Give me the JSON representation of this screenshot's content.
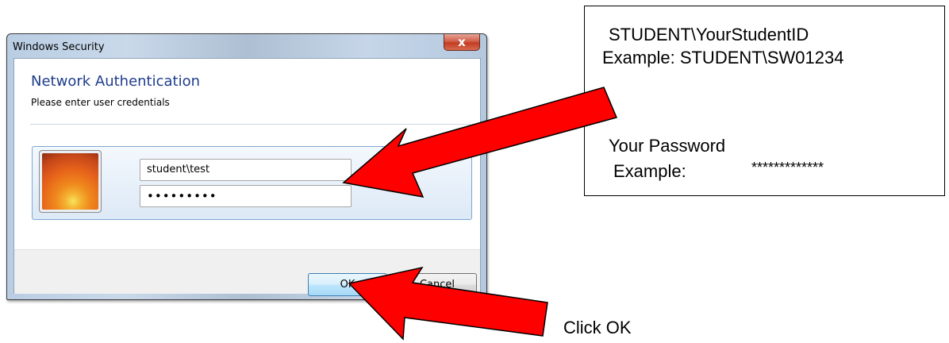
{
  "window": {
    "title": "Windows Security",
    "close_glyph": "x",
    "heading": "Network Authentication",
    "subtext": "Please enter user credentials"
  },
  "credentials": {
    "username_value": "student\\test",
    "password_value": "•••••••••",
    "avatar_icon": "flower-user-tile-icon"
  },
  "buttons": {
    "ok_label": "OK",
    "cancel_label": "Cancel"
  },
  "annotation": {
    "username_format": "STUDENT\\YourStudentID",
    "username_example": "Example: STUDENT\\SW01234",
    "password_label": "Your Password",
    "password_example_label": "Example:",
    "password_example_value": "*************",
    "click_instruction": "Click OK",
    "arrow_color": "#ff0000"
  }
}
